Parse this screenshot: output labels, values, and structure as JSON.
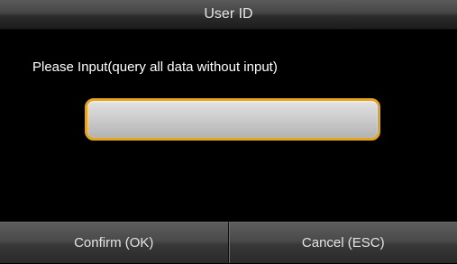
{
  "dialog": {
    "title": "User ID",
    "prompt": "Please Input(query all data without input)",
    "input": {
      "value": ""
    },
    "buttons": {
      "confirm_label": "Confirm (OK)",
      "cancel_label": "Cancel (ESC)"
    }
  },
  "colors": {
    "background": "#000000",
    "input_border_accent": "#e6a418",
    "input_fill": "#cccccc",
    "text": "#ffffff"
  }
}
